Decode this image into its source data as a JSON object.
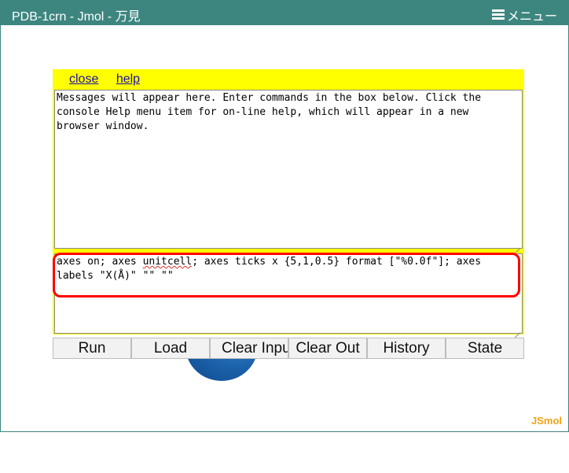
{
  "window": {
    "title": "PDB-1crn - Jmol - 万見",
    "menu_label": "メニュー"
  },
  "console": {
    "links": {
      "close": "close",
      "help": "help"
    },
    "messages": "Messages will appear here. Enter commands in the box below. Click the\nconsole Help menu item for on-line help, which will appear in a new\nbrowser window.",
    "input": {
      "before": "axes on; axes ",
      "misspelled": "unitcell",
      "after": "; axes ticks x {5,1,0.5} format [\"%0.0f\"]; axes\nlabels \"X(Å)\" \"\" \"\""
    },
    "buttons": [
      "Run",
      "Load",
      "Clear Input",
      "Clear Out",
      "History",
      "State"
    ]
  },
  "branding": {
    "jsmol": "JSmol"
  },
  "colors": {
    "titlebar": "#3d8680",
    "console_bg": "#ffff00",
    "highlight": "#ff0000",
    "brand": "#f3a317"
  }
}
